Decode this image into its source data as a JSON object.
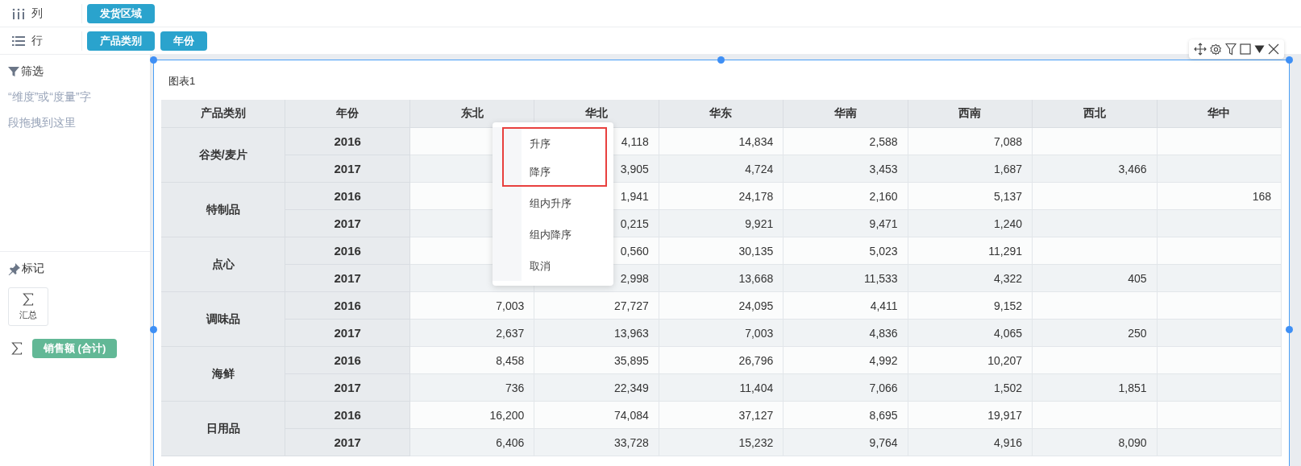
{
  "shelves": [
    {
      "kind": "columns",
      "label": "列",
      "pills": [
        "发货区域"
      ]
    },
    {
      "kind": "rows",
      "label": "行",
      "pills": [
        "产品类别",
        "年份"
      ]
    }
  ],
  "filter": {
    "title": "筛选",
    "hint": "“维度”或“度量”字段拖拽到这里"
  },
  "marks": {
    "title": "标记",
    "mark_type": "汇总",
    "measure": "销售额 (合计)"
  },
  "chart": {
    "title": "图表1",
    "columns": [
      "产品类别",
      "年份",
      "东北",
      "华北",
      "华东",
      "华南",
      "西南",
      "西北",
      "华中"
    ],
    "groups": [
      {
        "category": "谷类/麦片",
        "rows": [
          {
            "year": "2016",
            "values": {
              "1": "4,118",
              "2": "14,834",
              "3": "2,588",
              "4": "7,088"
            }
          },
          {
            "year": "2017",
            "values": {
              "1": "3,905",
              "2": "4,724",
              "3": "3,453",
              "4": "1,687",
              "5": "3,466"
            }
          }
        ]
      },
      {
        "category": "特制品",
        "rows": [
          {
            "year": "2016",
            "values": {
              "1": "1,941",
              "2": "24,178",
              "3": "2,160",
              "4": "5,137",
              "6": "168"
            }
          },
          {
            "year": "2017",
            "values": {
              "1": "0,215",
              "2": "9,921",
              "3": "9,471",
              "4": "1,240"
            }
          }
        ]
      },
      {
        "category": "点心",
        "rows": [
          {
            "year": "2016",
            "values": {
              "1": "0,560",
              "2": "30,135",
              "3": "5,023",
              "4": "11,291"
            }
          },
          {
            "year": "2017",
            "values": {
              "1": "2,998",
              "2": "13,668",
              "3": "11,533",
              "4": "4,322",
              "5": "405"
            }
          }
        ]
      },
      {
        "category": "调味品",
        "rows": [
          {
            "year": "2016",
            "values": {
              "0": "7,003",
              "1": "27,727",
              "2": "24,095",
              "3": "4,411",
              "4": "9,152"
            }
          },
          {
            "year": "2017",
            "values": {
              "0": "2,637",
              "1": "13,963",
              "2": "7,003",
              "3": "4,836",
              "4": "4,065",
              "5": "250"
            }
          }
        ]
      },
      {
        "category": "海鲜",
        "rows": [
          {
            "year": "2016",
            "values": {
              "0": "8,458",
              "1": "35,895",
              "2": "26,796",
              "3": "4,992",
              "4": "10,207"
            }
          },
          {
            "year": "2017",
            "values": {
              "0": "736",
              "1": "22,349",
              "2": "11,404",
              "3": "7,066",
              "4": "1,502",
              "5": "1,851"
            }
          }
        ]
      },
      {
        "category": "日用品",
        "rows": [
          {
            "year": "2016",
            "values": {
              "0": "16,200",
              "1": "74,084",
              "2": "37,127",
              "3": "8,695",
              "4": "19,917"
            }
          },
          {
            "year": "2017",
            "values": {
              "0": "6,406",
              "1": "33,728",
              "2": "15,232",
              "3": "9,764",
              "4": "4,916",
              "5": "8,090"
            }
          }
        ]
      }
    ]
  },
  "context_menu": {
    "items": [
      {
        "label": "升序",
        "boxed": true
      },
      {
        "label": "降序",
        "boxed": true
      },
      {
        "label": "组内升序",
        "boxed": false
      },
      {
        "label": "组内降序",
        "boxed": false
      },
      {
        "label": "取消",
        "boxed": false
      }
    ]
  }
}
